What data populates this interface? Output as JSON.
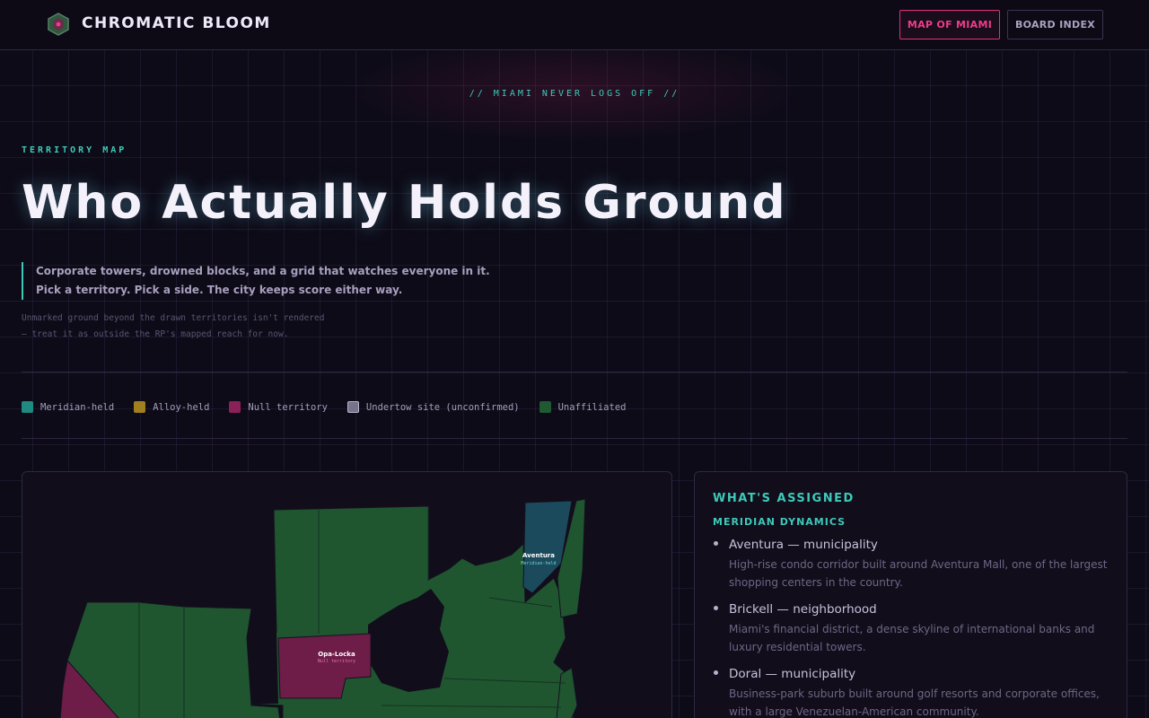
{
  "header": {
    "brand": "CHROMATIC BLOOM",
    "nav": {
      "map": "MAP OF MIAMI",
      "board": "BOARD INDEX"
    }
  },
  "hero": {
    "tagline": "// MIAMI NEVER LOGS OFF //",
    "eyebrow": "TERRITORY MAP",
    "title": "Who Actually Holds Ground",
    "lede_line1": "Corporate towers, drowned blocks, and a grid that watches everyone in it.",
    "lede_line2": "Pick a territory. Pick a side. The city keeps score either way.",
    "note_line1": "Unmarked ground beyond the drawn territories isn't rendered",
    "note_line2": "— treat it as outside the RP's mapped reach for now."
  },
  "legend": [
    {
      "label": "Meridian-held",
      "color": "#1f8a80"
    },
    {
      "label": "Alloy-held",
      "color": "#a07f1e"
    },
    {
      "label": "Null territory",
      "color": "#8a2158"
    },
    {
      "label": "Undertow site (unconfirmed)",
      "color": "#77738a"
    },
    {
      "label": "Unaffiliated",
      "color": "#1f5a32"
    }
  ],
  "map": {
    "labels": [
      {
        "name": "Aventura",
        "status": "Meridian-held"
      },
      {
        "name": "Opa-Locka",
        "status": "Null territory"
      }
    ],
    "colors": {
      "unaffiliated": "#1f5630",
      "meridian": "#1b4a5c",
      "null": "#6e1c48",
      "background": "#110d1b"
    }
  },
  "info": {
    "heading": "WHAT'S ASSIGNED",
    "faction": "MERIDIAN DYNAMICS",
    "items": [
      {
        "name": "Aventura — municipality",
        "desc": "High-rise condo corridor built around Aventura Mall, one of the largest shopping centers in the country."
      },
      {
        "name": "Brickell — neighborhood",
        "desc": "Miami's financial district, a dense skyline of international banks and luxury residential towers."
      },
      {
        "name": "Doral — municipality",
        "desc": "Business-park suburb built around golf resorts and corporate offices, with a large Venezuelan-American community."
      }
    ]
  }
}
